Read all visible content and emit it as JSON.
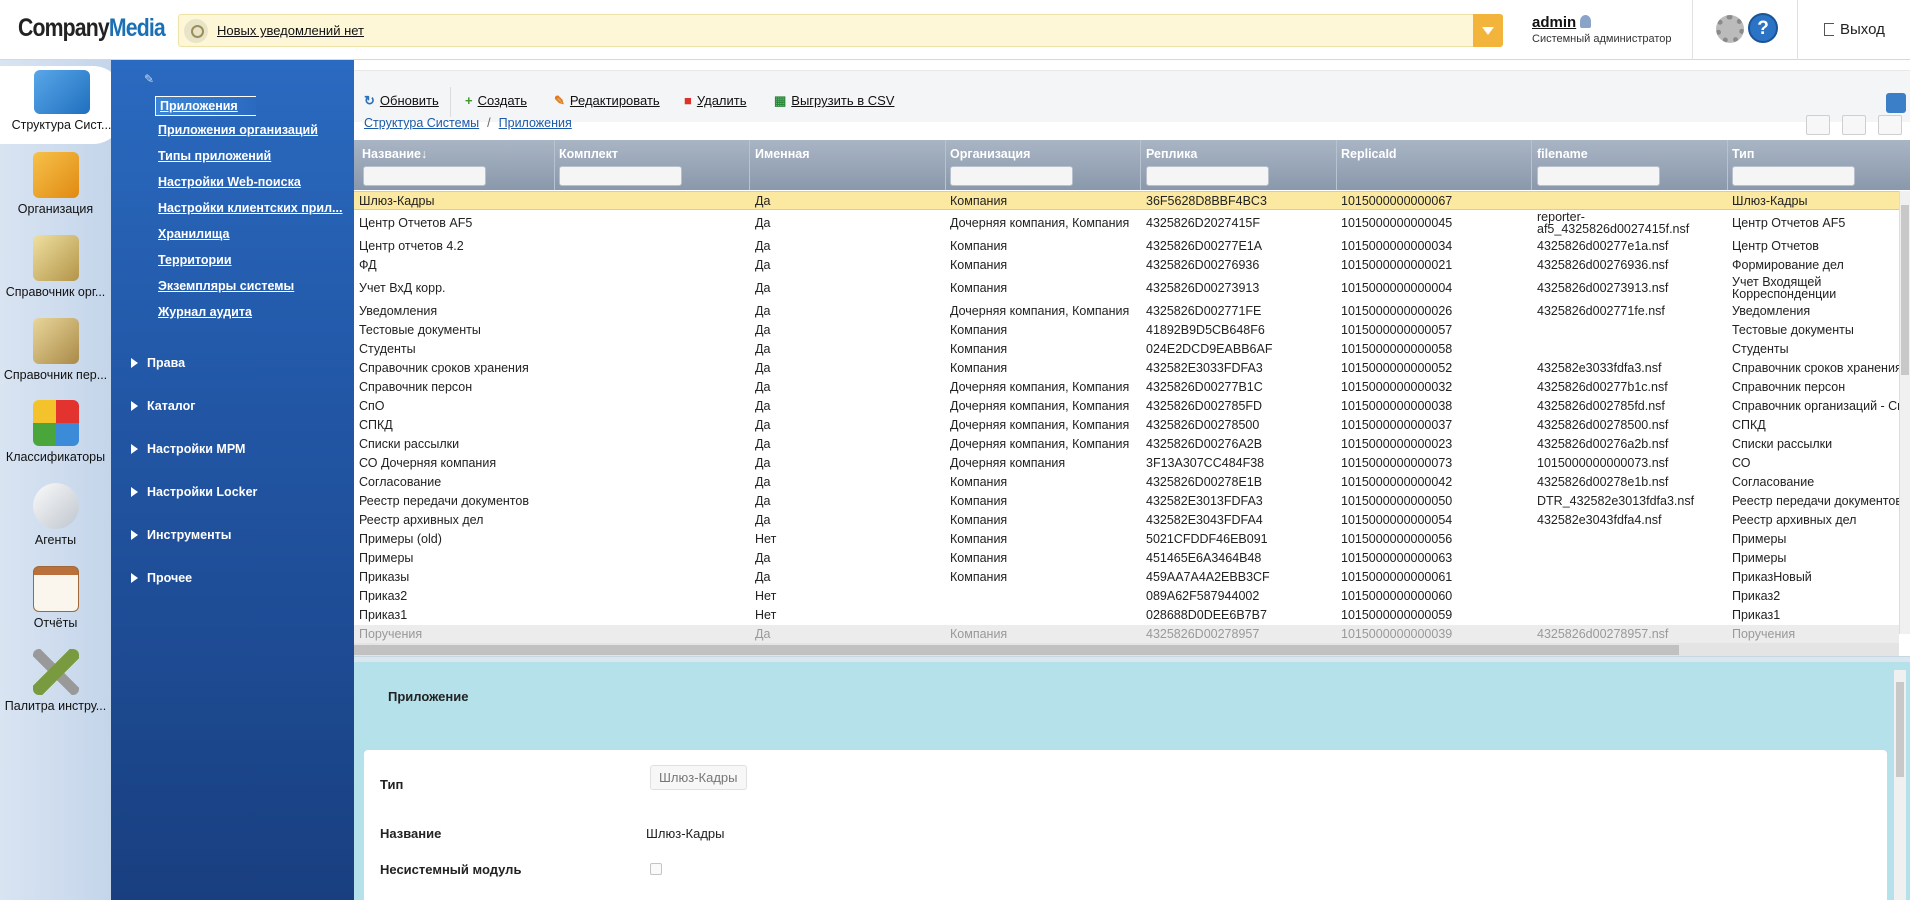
{
  "header": {
    "logo_a": "Company",
    "logo_b": "Media",
    "notification": "Новых уведомлений нет",
    "user_name": "admin",
    "user_role": "Системный администратор",
    "logout": "Выход",
    "help": "?"
  },
  "iconbar": [
    {
      "label": "Структура Сист...",
      "icon": "system-structure-icon",
      "color": "#3a86d1"
    },
    {
      "label": "Организация",
      "icon": "organization-icon",
      "color": "#f0a21e"
    },
    {
      "label": "Справочник орг...",
      "icon": "org-directory-icon",
      "color": "#c9b46a"
    },
    {
      "label": "Справочник пер...",
      "icon": "person-directory-icon",
      "color": "#c9a85e"
    },
    {
      "label": "Классификаторы",
      "icon": "classifiers-icon",
      "color": "#4a9a3a"
    },
    {
      "label": "Агенты",
      "icon": "agents-icon",
      "color": "#d9d9d9"
    },
    {
      "label": "Отчёты",
      "icon": "reports-icon",
      "color": "#c8a070"
    },
    {
      "label": "Палитра инстру...",
      "icon": "tools-icon",
      "color": "#8aa050"
    }
  ],
  "nav": {
    "links": [
      "Приложения",
      "Приложения организаций",
      "Типы приложений",
      "Настройки Web-поиска",
      "Настройки клиентских прил...",
      "Хранилища",
      "Территории",
      "Экземпляры системы",
      "Журнал аудита"
    ],
    "sections": [
      "Права",
      "Каталог",
      "Настройки МРМ",
      "Настройки Locker",
      "Инструменты",
      "Прочее"
    ]
  },
  "toolbar": {
    "refresh": "Обновить",
    "create": "Создать",
    "edit": "Редактировать",
    "delete": "Удалить",
    "export": "Выгрузить в CSV"
  },
  "breadcrumb": {
    "root": "Структура Системы",
    "current": "Приложения"
  },
  "grid": {
    "columns": [
      "Название↓",
      "Комплект",
      "Именная",
      "Организация",
      "Реплика",
      "ReplicaId",
      "filename",
      "Тип"
    ],
    "rows": [
      {
        "name": "Шлюз-Кадры",
        "named": "Да",
        "org": "Компания",
        "replica": "36F5628D8BBF4BC3",
        "rid": "1015000000000067",
        "file": "",
        "type": "Шлюз-Кадры"
      },
      {
        "name": "Центр Отчетов AF5",
        "named": "Да",
        "org": "Дочерняя компания, Компания",
        "replica": "4325826D2027415F",
        "rid": "1015000000000045",
        "file": "reporter-af5_4325826d0027415f.nsf",
        "type": "Центр Отчетов AF5"
      },
      {
        "name": "Центр отчетов 4.2",
        "named": "Да",
        "org": "Компания",
        "replica": "4325826D00277E1A",
        "rid": "1015000000000034",
        "file": "4325826d00277e1a.nsf",
        "type": "Центр Отчетов"
      },
      {
        "name": "ФД",
        "named": "Да",
        "org": "Компания",
        "replica": "4325826D00276936",
        "rid": "1015000000000021",
        "file": "4325826d00276936.nsf",
        "type": "Формирование дел"
      },
      {
        "name": "Учет ВхД корр.",
        "named": "Да",
        "org": "Компания",
        "replica": "4325826D00273913",
        "rid": "1015000000000004",
        "file": "4325826d00273913.nsf",
        "type": "Учет Входящей Корреспонденции"
      },
      {
        "name": "Уведомления",
        "named": "Да",
        "org": "Дочерняя компания, Компания",
        "replica": "4325826D002771FE",
        "rid": "1015000000000026",
        "file": "4325826d002771fe.nsf",
        "type": "Уведомления"
      },
      {
        "name": "Тестовые документы",
        "named": "Да",
        "org": "Компания",
        "replica": "41892B9D5CB648F6",
        "rid": "1015000000000057",
        "file": "",
        "type": "Тестовые документы"
      },
      {
        "name": "Студенты",
        "named": "Да",
        "org": "Компания",
        "replica": "024E2DCD9EABB6AF",
        "rid": "1015000000000058",
        "file": "",
        "type": "Студенты"
      },
      {
        "name": "Справочник сроков хранения",
        "named": "Да",
        "org": "Компания",
        "replica": "432582E3033FDFA3",
        "rid": "1015000000000052",
        "file": "432582e3033fdfa3.nsf",
        "type": "Справочник сроков хранения"
      },
      {
        "name": "Справочник персон",
        "named": "Да",
        "org": "Дочерняя компания, Компания",
        "replica": "4325826D00277B1C",
        "rid": "1015000000000032",
        "file": "4325826d00277b1c.nsf",
        "type": "Справочник персон"
      },
      {
        "name": "СпО",
        "named": "Да",
        "org": "Дочерняя компания, Компания",
        "replica": "4325826D002785FD",
        "rid": "1015000000000038",
        "file": "4325826d002785fd.nsf",
        "type": "Справочник организаций - СпО"
      },
      {
        "name": "СПКД",
        "named": "Да",
        "org": "Дочерняя компания, Компания",
        "replica": "4325826D00278500",
        "rid": "1015000000000037",
        "file": "4325826d00278500.nsf",
        "type": "СПКД"
      },
      {
        "name": "Списки рассылки",
        "named": "Да",
        "org": "Дочерняя компания, Компания",
        "replica": "4325826D00276A2B",
        "rid": "1015000000000023",
        "file": "4325826d00276a2b.nsf",
        "type": "Списки рассылки"
      },
      {
        "name": "СО Дочерняя компания",
        "named": "Да",
        "org": "Дочерняя компания",
        "replica": "3F13A307CC484F38",
        "rid": "1015000000000073",
        "file": "1015000000000073.nsf",
        "type": "СО"
      },
      {
        "name": "Согласование",
        "named": "Да",
        "org": "Компания",
        "replica": "4325826D00278E1B",
        "rid": "1015000000000042",
        "file": "4325826d00278e1b.nsf",
        "type": "Согласование"
      },
      {
        "name": "Реестр передачи документов",
        "named": "Да",
        "org": "Компания",
        "replica": "432582E3013FDFA3",
        "rid": "1015000000000050",
        "file": "DTR_432582e3013fdfa3.nsf",
        "type": "Реестр передачи документов"
      },
      {
        "name": "Реестр архивных дел",
        "named": "Да",
        "org": "Компания",
        "replica": "432582E3043FDFA4",
        "rid": "1015000000000054",
        "file": "432582e3043fdfa4.nsf",
        "type": "Реестр архивных дел"
      },
      {
        "name": "Примеры (old)",
        "named": "Нет",
        "org": "Компания",
        "replica": "5021CFDDF46EB091",
        "rid": "1015000000000056",
        "file": "",
        "type": "Примеры"
      },
      {
        "name": "Примеры",
        "named": "Да",
        "org": "Компания",
        "replica": "451465E6A3464B48",
        "rid": "1015000000000063",
        "file": "",
        "type": "Примеры"
      },
      {
        "name": "Приказы",
        "named": "Да",
        "org": "Компания",
        "replica": "459AA7A4A2EBB3CF",
        "rid": "1015000000000061",
        "file": "",
        "type": "ПриказНовый"
      },
      {
        "name": "Приказ2",
        "named": "Нет",
        "org": "",
        "replica": "089A62F587944002",
        "rid": "1015000000000060",
        "file": "",
        "type": "Приказ2"
      },
      {
        "name": "Приказ1",
        "named": "Нет",
        "org": "",
        "replica": "028688D0DEE6B7B7",
        "rid": "1015000000000059",
        "file": "",
        "type": "Приказ1"
      },
      {
        "name": "Поручения",
        "named": "Да",
        "org": "Компания",
        "replica": "4325826D00278957",
        "rid": "1015000000000039",
        "file": "4325826d00278957.nsf",
        "type": "Поручения"
      }
    ]
  },
  "details": {
    "title": "Приложение",
    "type_label": "Тип",
    "type_value": "Шлюз-Кадры",
    "name_label": "Название",
    "name_value": "Шлюз-Кадры",
    "nonsystem_label": "Несистемный модуль"
  }
}
